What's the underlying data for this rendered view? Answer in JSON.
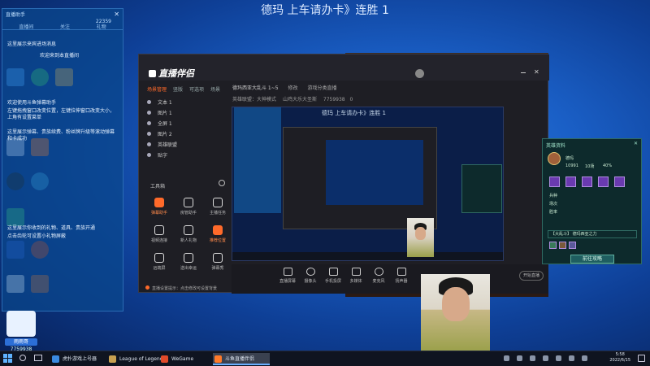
{
  "stream_title": "德玛 上车请办卡》连胜 1",
  "danmaku_panel": {
    "title": "直播助手",
    "count": "22359",
    "tabs": [
      "直播间",
      "关注",
      "礼物"
    ],
    "messages": [
      "这里展示来宾进场消息",
      "欢迎来到本直播间",
      "欢迎使用斗鱼弹幕助手",
      "左键拖拽窗口改变位置，左键拉伸窗口改变大小，上角有设置菜单",
      "这里展示弹幕、贵族续费、粉丝牌升级等滚动弹幕和卡成功",
      "这里展示你收到的礼物、道具、贵族开通",
      "点击齿轮可设置小礼物屏蔽"
    ]
  },
  "app": {
    "logo": "直播伴侣",
    "left_tabs": [
      "场景管理",
      "竖版",
      "可选项",
      "场景"
    ],
    "scenes": [
      "文本 1",
      "图片 1",
      "全屏 1",
      "图片 2",
      "英雄联盟",
      "贴字"
    ],
    "tools_title": "工具箱",
    "tools": [
      {
        "label": "弹幕助手",
        "highlight": true
      },
      {
        "label": "房管助手",
        "highlight": false
      },
      {
        "label": "主播任务",
        "highlight": false
      },
      {
        "label": "视频连接",
        "highlight": false
      },
      {
        "label": "新人礼物",
        "highlight": false
      },
      {
        "label": "推荐位置",
        "highlight": true
      },
      {
        "label": "远端屏",
        "highlight": false
      },
      {
        "label": "送出幸运",
        "highlight": false
      },
      {
        "label": "弹幕秀",
        "highlight": false
      }
    ],
    "room_title": "德玛西亚大乱斗 1~5",
    "room_btn": "修改",
    "room_notice": "游戏分类直播",
    "room_category": "英雄联盟：大神模式",
    "room_host": "山鸡大乐大圣斯",
    "room_id": "7759938",
    "room_fans": "0",
    "preview_title": "德玛 上车请办卡》连胜 1",
    "bottom_buttons": [
      "直播屏幕",
      "摄像头",
      "手机投屏",
      "多媒体",
      "麦克风",
      "扬声器"
    ],
    "start_button": "开始直播",
    "footer_notice": "直播设置提示：点击修改可设置背景"
  },
  "hero_panel": {
    "title": "英雄资料",
    "hero_name": "德玛",
    "stats": [
      "10991",
      "10场",
      "40%"
    ],
    "labels": [
      "兵种",
      "场次",
      "胜率"
    ],
    "select_value": "【大乱斗】 德玛西亚之力",
    "button": "前往攻略"
  },
  "badge": {
    "name": "雨雨哥",
    "number": "7759938"
  },
  "taskbar": {
    "items": [
      "虎扑游戏上号器",
      "League of Legends",
      "WeGame",
      "斗鱼直播伴侣"
    ],
    "time": "5:58",
    "date": "2022/6/15"
  },
  "colors": {
    "accent": "#ff6a2a",
    "desktop": "#1a5fc6",
    "panel": "#0d2a2c"
  }
}
